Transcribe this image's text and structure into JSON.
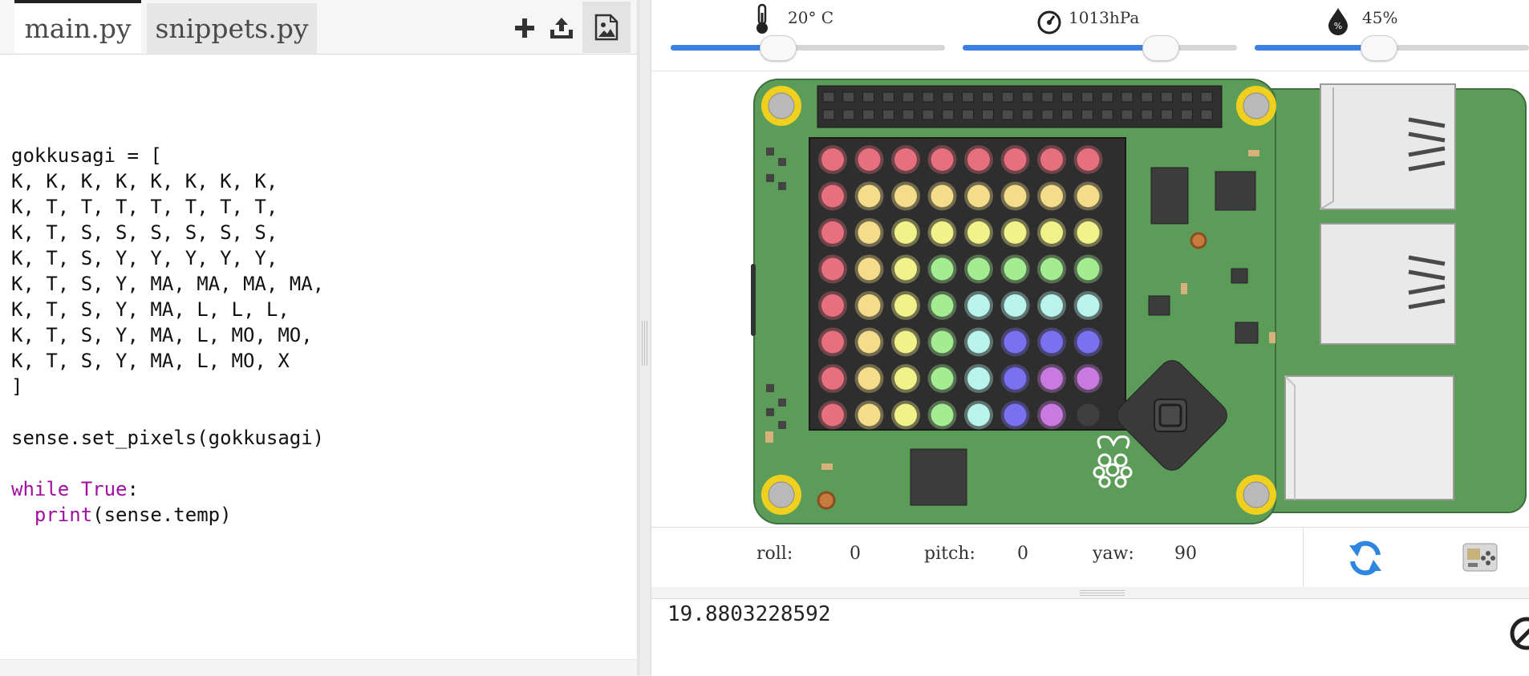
{
  "editor": {
    "tabs": [
      {
        "label": "main.py",
        "active": true
      },
      {
        "label": "snippets.py",
        "active": false
      }
    ],
    "toolbar": {
      "add_icon": "plus-icon",
      "upload_icon": "upload-icon",
      "image_icon": "image-icon"
    },
    "code": {
      "line1": "gokkusagi = [",
      "rows": [
        "K, K, K, K, K, K, K, K,",
        "K, T, T, T, T, T, T, T,",
        "K, T, S, S, S, S, S, S,",
        "K, T, S, Y, Y, Y, Y, Y,",
        "K, T, S, Y, MA, MA, MA, MA,",
        "K, T, S, Y, MA, L, L, L,",
        "K, T, S, Y, MA, L, MO, MO,",
        "K, T, S, Y, MA, L, MO, X"
      ],
      "close": "]",
      "set_pixels": "sense.set_pixels(gokkusagi)",
      "while_kw": "while",
      "true_kw": "True",
      "colon": ":",
      "print_kw": "print",
      "print_args": "(sense.temp)"
    }
  },
  "sensors": {
    "temperature": {
      "label": "20° C",
      "icon": "thermometer-icon",
      "level": 0.39
    },
    "pressure": {
      "label": "1013hPa",
      "icon": "gauge-icon",
      "level": 0.72
    },
    "humidity": {
      "label": "45%",
      "icon": "humidity-drop-icon",
      "level": 0.45
    }
  },
  "led_matrix": {
    "palette": {
      "K": "#e8707e",
      "T": "#f4dc8a",
      "S": "#f2f28a",
      "Y": "#a4ec92",
      "MA": "#b8f4ec",
      "L": "#7a70f0",
      "MO": "#c87ae0",
      "X": "#3f3f3f"
    },
    "grid": [
      [
        "K",
        "K",
        "K",
        "K",
        "K",
        "K",
        "K",
        "K"
      ],
      [
        "K",
        "T",
        "T",
        "T",
        "T",
        "T",
        "T",
        "T"
      ],
      [
        "K",
        "T",
        "S",
        "S",
        "S",
        "S",
        "S",
        "S"
      ],
      [
        "K",
        "T",
        "S",
        "Y",
        "Y",
        "Y",
        "Y",
        "Y"
      ],
      [
        "K",
        "T",
        "S",
        "Y",
        "MA",
        "MA",
        "MA",
        "MA"
      ],
      [
        "K",
        "T",
        "S",
        "Y",
        "MA",
        "L",
        "L",
        "L"
      ],
      [
        "K",
        "T",
        "S",
        "Y",
        "MA",
        "L",
        "MO",
        "MO"
      ],
      [
        "K",
        "T",
        "S",
        "Y",
        "MA",
        "L",
        "MO",
        "X"
      ]
    ]
  },
  "board": {
    "pcb_color": "#5c9c59",
    "logo_icon": "raspberry-pi-icon",
    "joystick_icon": "joystick-icon"
  },
  "orientation": {
    "roll_label": "roll:",
    "roll_value": "0",
    "pitch_label": "pitch:",
    "pitch_value": "0",
    "yaw_label": "yaw:",
    "yaw_value": "90",
    "reset_icon": "refresh-icon",
    "board_toggle_icon": "sense-hat-icon"
  },
  "console": {
    "output": "19.8803228592",
    "clear_icon": "clear-icon"
  },
  "colors": {
    "accent": "#3b82e0",
    "keyword": "#a010a0"
  }
}
